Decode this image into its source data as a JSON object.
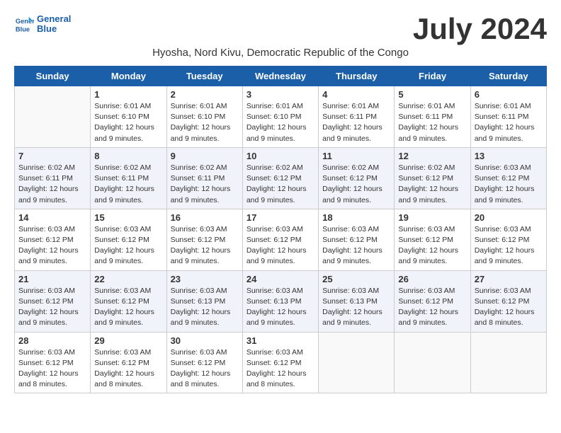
{
  "header": {
    "logo_line1": "General",
    "logo_line2": "Blue",
    "month_year": "July 2024",
    "subtitle": "Hyosha, Nord Kivu, Democratic Republic of the Congo"
  },
  "weekdays": [
    "Sunday",
    "Monday",
    "Tuesday",
    "Wednesday",
    "Thursday",
    "Friday",
    "Saturday"
  ],
  "weeks": [
    [
      {
        "day": "",
        "info": ""
      },
      {
        "day": "1",
        "info": "Sunrise: 6:01 AM\nSunset: 6:10 PM\nDaylight: 12 hours\nand 9 minutes."
      },
      {
        "day": "2",
        "info": "Sunrise: 6:01 AM\nSunset: 6:10 PM\nDaylight: 12 hours\nand 9 minutes."
      },
      {
        "day": "3",
        "info": "Sunrise: 6:01 AM\nSunset: 6:10 PM\nDaylight: 12 hours\nand 9 minutes."
      },
      {
        "day": "4",
        "info": "Sunrise: 6:01 AM\nSunset: 6:11 PM\nDaylight: 12 hours\nand 9 minutes."
      },
      {
        "day": "5",
        "info": "Sunrise: 6:01 AM\nSunset: 6:11 PM\nDaylight: 12 hours\nand 9 minutes."
      },
      {
        "day": "6",
        "info": "Sunrise: 6:01 AM\nSunset: 6:11 PM\nDaylight: 12 hours\nand 9 minutes."
      }
    ],
    [
      {
        "day": "7",
        "info": "Sunrise: 6:02 AM\nSunset: 6:11 PM\nDaylight: 12 hours\nand 9 minutes."
      },
      {
        "day": "8",
        "info": "Sunrise: 6:02 AM\nSunset: 6:11 PM\nDaylight: 12 hours\nand 9 minutes."
      },
      {
        "day": "9",
        "info": "Sunrise: 6:02 AM\nSunset: 6:11 PM\nDaylight: 12 hours\nand 9 minutes."
      },
      {
        "day": "10",
        "info": "Sunrise: 6:02 AM\nSunset: 6:12 PM\nDaylight: 12 hours\nand 9 minutes."
      },
      {
        "day": "11",
        "info": "Sunrise: 6:02 AM\nSunset: 6:12 PM\nDaylight: 12 hours\nand 9 minutes."
      },
      {
        "day": "12",
        "info": "Sunrise: 6:02 AM\nSunset: 6:12 PM\nDaylight: 12 hours\nand 9 minutes."
      },
      {
        "day": "13",
        "info": "Sunrise: 6:03 AM\nSunset: 6:12 PM\nDaylight: 12 hours\nand 9 minutes."
      }
    ],
    [
      {
        "day": "14",
        "info": "Sunrise: 6:03 AM\nSunset: 6:12 PM\nDaylight: 12 hours\nand 9 minutes."
      },
      {
        "day": "15",
        "info": "Sunrise: 6:03 AM\nSunset: 6:12 PM\nDaylight: 12 hours\nand 9 minutes."
      },
      {
        "day": "16",
        "info": "Sunrise: 6:03 AM\nSunset: 6:12 PM\nDaylight: 12 hours\nand 9 minutes."
      },
      {
        "day": "17",
        "info": "Sunrise: 6:03 AM\nSunset: 6:12 PM\nDaylight: 12 hours\nand 9 minutes."
      },
      {
        "day": "18",
        "info": "Sunrise: 6:03 AM\nSunset: 6:12 PM\nDaylight: 12 hours\nand 9 minutes."
      },
      {
        "day": "19",
        "info": "Sunrise: 6:03 AM\nSunset: 6:12 PM\nDaylight: 12 hours\nand 9 minutes."
      },
      {
        "day": "20",
        "info": "Sunrise: 6:03 AM\nSunset: 6:12 PM\nDaylight: 12 hours\nand 9 minutes."
      }
    ],
    [
      {
        "day": "21",
        "info": "Sunrise: 6:03 AM\nSunset: 6:12 PM\nDaylight: 12 hours\nand 9 minutes."
      },
      {
        "day": "22",
        "info": "Sunrise: 6:03 AM\nSunset: 6:12 PM\nDaylight: 12 hours\nand 9 minutes."
      },
      {
        "day": "23",
        "info": "Sunrise: 6:03 AM\nSunset: 6:13 PM\nDaylight: 12 hours\nand 9 minutes."
      },
      {
        "day": "24",
        "info": "Sunrise: 6:03 AM\nSunset: 6:13 PM\nDaylight: 12 hours\nand 9 minutes."
      },
      {
        "day": "25",
        "info": "Sunrise: 6:03 AM\nSunset: 6:13 PM\nDaylight: 12 hours\nand 9 minutes."
      },
      {
        "day": "26",
        "info": "Sunrise: 6:03 AM\nSunset: 6:12 PM\nDaylight: 12 hours\nand 9 minutes."
      },
      {
        "day": "27",
        "info": "Sunrise: 6:03 AM\nSunset: 6:12 PM\nDaylight: 12 hours\nand 8 minutes."
      }
    ],
    [
      {
        "day": "28",
        "info": "Sunrise: 6:03 AM\nSunset: 6:12 PM\nDaylight: 12 hours\nand 8 minutes."
      },
      {
        "day": "29",
        "info": "Sunrise: 6:03 AM\nSunset: 6:12 PM\nDaylight: 12 hours\nand 8 minutes."
      },
      {
        "day": "30",
        "info": "Sunrise: 6:03 AM\nSunset: 6:12 PM\nDaylight: 12 hours\nand 8 minutes."
      },
      {
        "day": "31",
        "info": "Sunrise: 6:03 AM\nSunset: 6:12 PM\nDaylight: 12 hours\nand 8 minutes."
      },
      {
        "day": "",
        "info": ""
      },
      {
        "day": "",
        "info": ""
      },
      {
        "day": "",
        "info": ""
      }
    ]
  ]
}
